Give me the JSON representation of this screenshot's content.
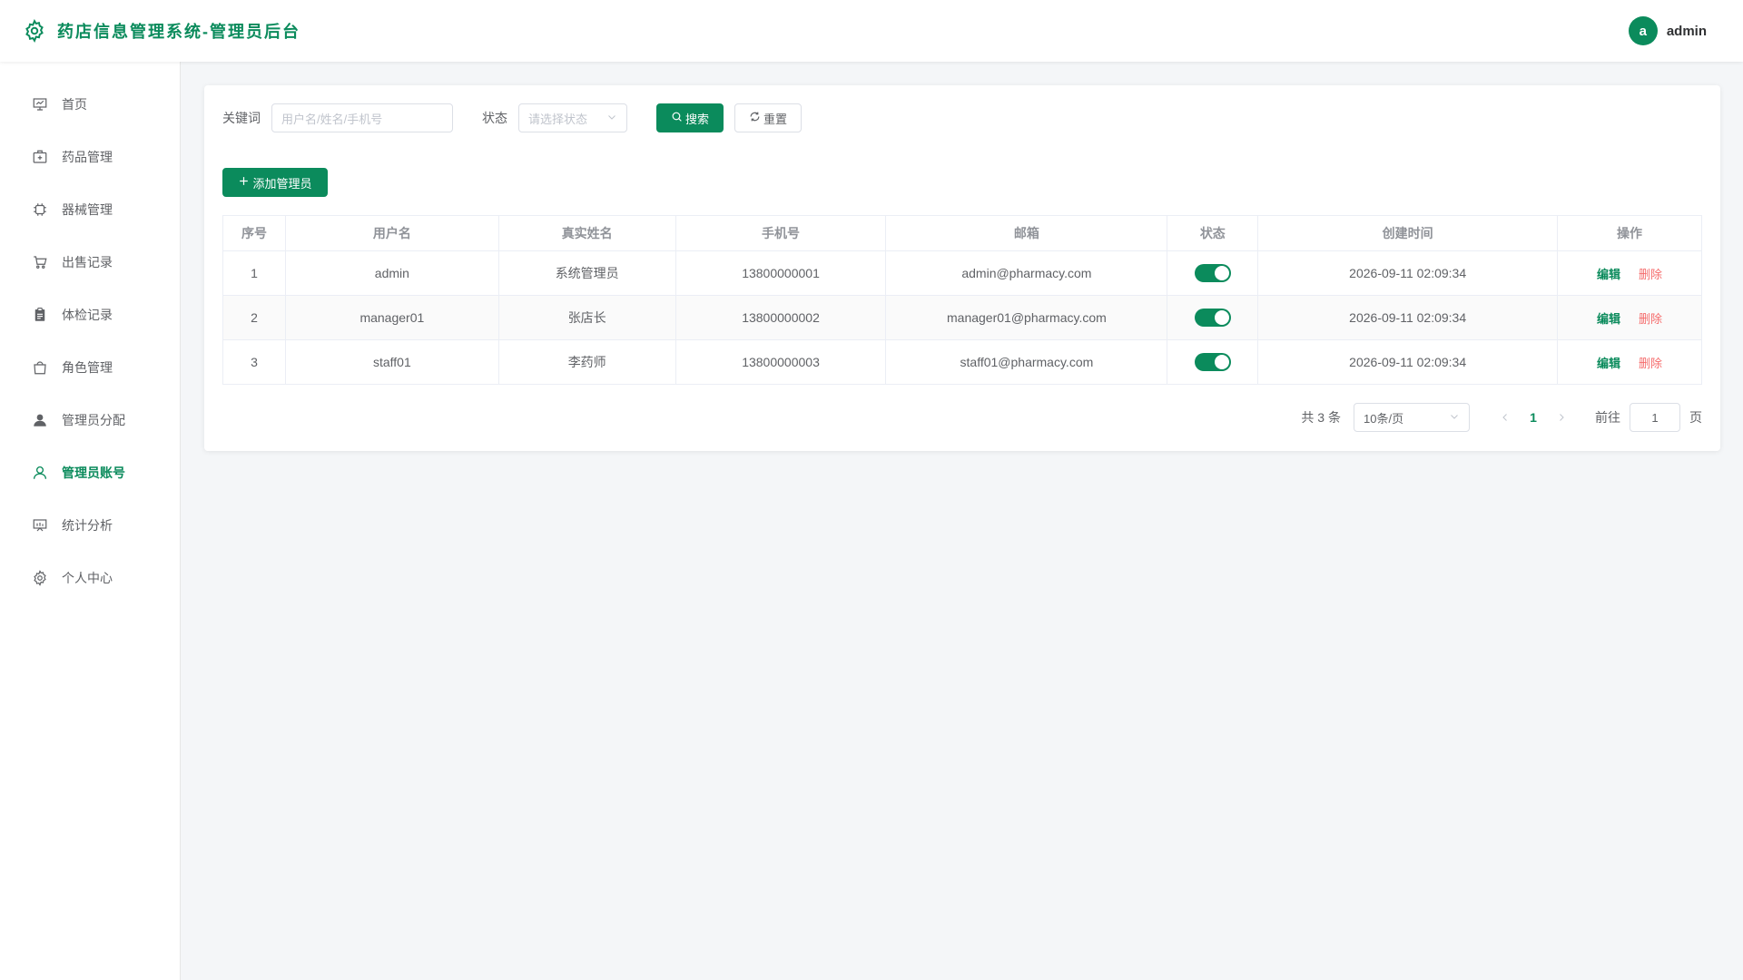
{
  "header": {
    "title": "药店信息管理系统-管理员后台",
    "user": {
      "avatar_letter": "a",
      "name": "admin"
    }
  },
  "sidebar": {
    "items": [
      {
        "label": "首页",
        "icon": "presentation-icon"
      },
      {
        "label": "药品管理",
        "icon": "medicine-box-icon"
      },
      {
        "label": "器械管理",
        "icon": "cpu-icon"
      },
      {
        "label": "出售记录",
        "icon": "cart-icon"
      },
      {
        "label": "体检记录",
        "icon": "clipboard-icon"
      },
      {
        "label": "角色管理",
        "icon": "bag-icon"
      },
      {
        "label": "管理员分配",
        "icon": "user-filled-icon"
      },
      {
        "label": "管理员账号",
        "icon": "user-icon",
        "active": true
      },
      {
        "label": "统计分析",
        "icon": "data-board-icon"
      },
      {
        "label": "个人中心",
        "icon": "setting-icon"
      }
    ]
  },
  "search": {
    "keyword_label": "关键词",
    "keyword_placeholder": "用户名/姓名/手机号",
    "status_label": "状态",
    "status_placeholder": "请选择状态",
    "search_button": "搜索",
    "reset_button": "重置"
  },
  "toolbar": {
    "add_button": "添加管理员"
  },
  "table": {
    "columns": [
      "序号",
      "用户名",
      "真实姓名",
      "手机号",
      "邮箱",
      "状态",
      "操作",
      "创建时间"
    ],
    "headers": {
      "index": "序号",
      "username": "用户名",
      "realname": "真实姓名",
      "phone": "手机号",
      "email": "邮箱",
      "status": "状态",
      "created": "创建时间",
      "actions": "操作"
    },
    "rows": [
      {
        "index": "1",
        "username": "admin",
        "realname": "系统管理员",
        "phone": "13800000001",
        "email": "admin@pharmacy.com",
        "enabled": true,
        "created": "2026-09-11 02:09:34"
      },
      {
        "index": "2",
        "username": "manager01",
        "realname": "张店长",
        "phone": "13800000002",
        "email": "manager01@pharmacy.com",
        "enabled": true,
        "created": "2026-09-11 02:09:34"
      },
      {
        "index": "3",
        "username": "staff01",
        "realname": "李药师",
        "phone": "13800000003",
        "email": "staff01@pharmacy.com",
        "enabled": true,
        "created": "2026-09-11 02:09:34"
      }
    ],
    "edit_label": "编辑",
    "delete_label": "删除"
  },
  "pagination": {
    "total_text": "共 3 条",
    "page_size": "10条/页",
    "current_page": "1",
    "goto_label": "前往",
    "goto_value": "1",
    "page_suffix": "页"
  },
  "colors": {
    "primary": "#0b8b5c",
    "danger": "#f56c6c",
    "background": "#f4f6f8"
  }
}
